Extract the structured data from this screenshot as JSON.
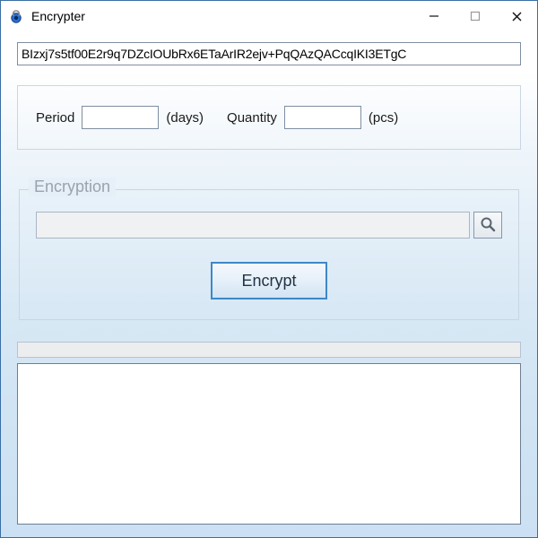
{
  "window": {
    "title": "Encrypter"
  },
  "key": {
    "value": "BIzxj7s5tf00E2r9q7DZcIOUbRx6ETaArIR2ejv+PqQAzQACcqIKI3ETgC"
  },
  "params": {
    "period_label": "Period",
    "period_value": "",
    "period_unit": "(days)",
    "quantity_label": "Quantity",
    "quantity_value": "",
    "quantity_unit": "(pcs)"
  },
  "group": {
    "title": "Encryption",
    "path_value": "",
    "encrypt_label": "Encrypt"
  },
  "output": {
    "value": ""
  }
}
